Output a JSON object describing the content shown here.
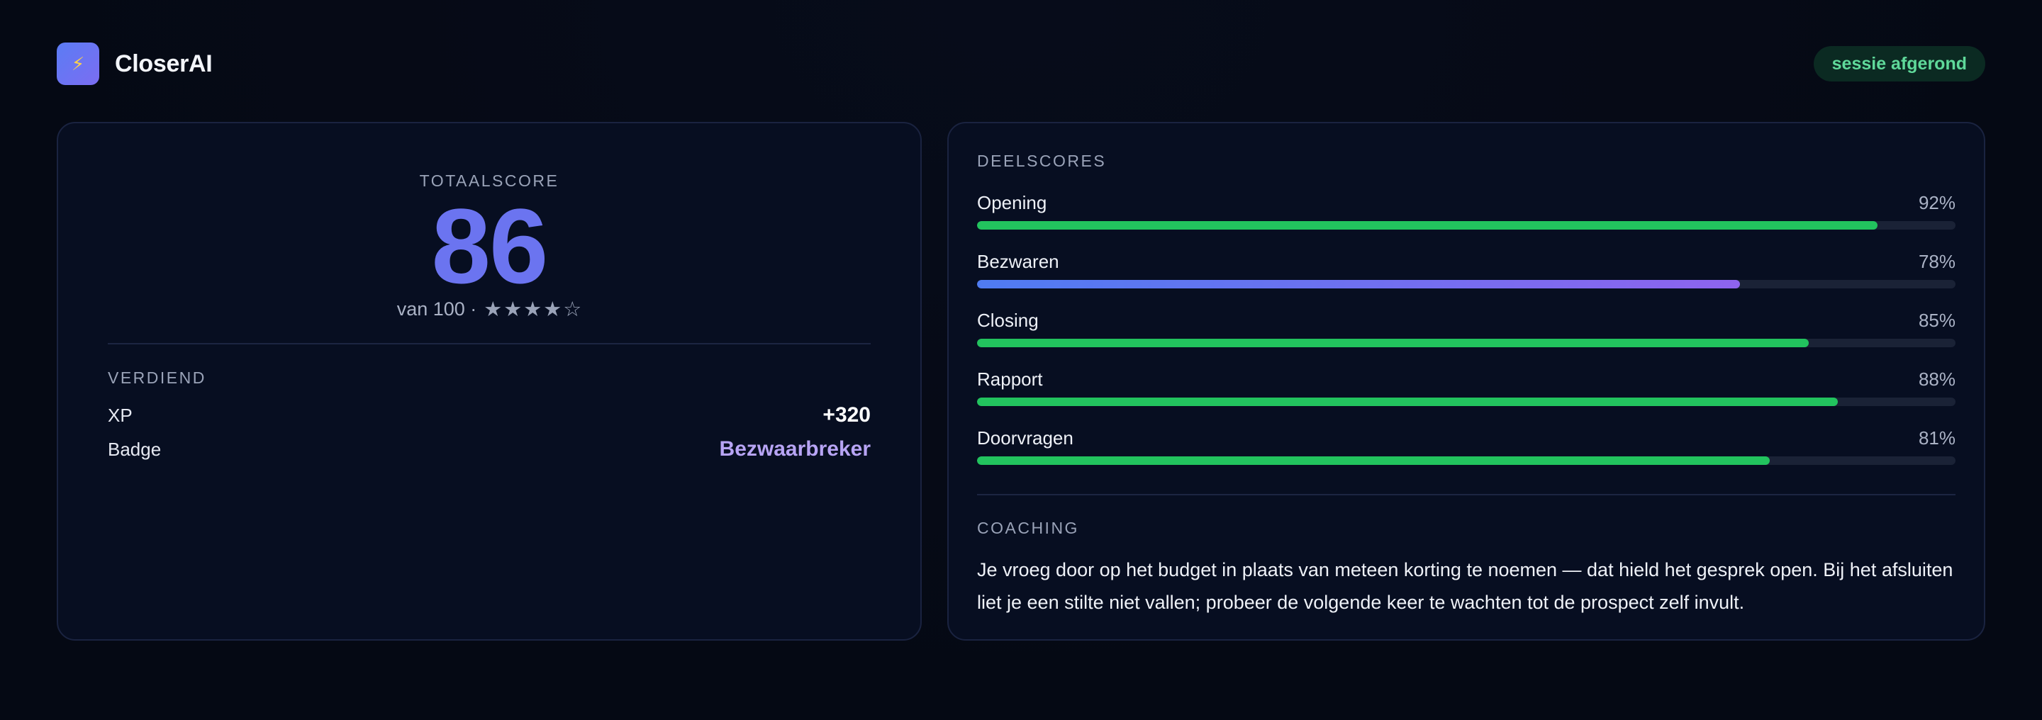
{
  "header": {
    "logo_icon": "lightning-icon",
    "app_name": "CloserAI",
    "status": "sessie afgerond"
  },
  "score": {
    "label": "TOTAALSCORE",
    "value": "86",
    "out_of": "van 100 ·",
    "stars_filled": 4,
    "stars_total": 5,
    "stars_text": "★★★★☆"
  },
  "earned": {
    "label": "VERDIEND",
    "xp_label": "XP",
    "xp_value": "+320",
    "badge_label": "Badge",
    "badge_value": "Bezwaarbreker"
  },
  "subscores": {
    "label": "DEELSCORES",
    "items": [
      {
        "name": "Opening",
        "pct_text": "92%",
        "value": 92,
        "style": "green"
      },
      {
        "name": "Bezwaren",
        "pct_text": "78%",
        "value": 78,
        "style": "gradient"
      },
      {
        "name": "Closing",
        "pct_text": "85%",
        "value": 85,
        "style": "green"
      },
      {
        "name": "Rapport",
        "pct_text": "88%",
        "value": 88,
        "style": "green"
      },
      {
        "name": "Doorvragen",
        "pct_text": "81%",
        "value": 81,
        "style": "green"
      }
    ]
  },
  "coaching": {
    "label": "COACHING",
    "text": "Je vroeg door op het budget in plaats van meteen korting te noemen — dat hield het gesprek open. Bij het afsluiten liet je een stilte niet vallen; probeer de volgende keer te wachten tot de prospect zelf invult."
  },
  "colors": {
    "accent": "#6b74f0",
    "bar_green": "#22c35e",
    "badge_purple": "#b7a4f4",
    "status_green": "#5fd99a"
  }
}
